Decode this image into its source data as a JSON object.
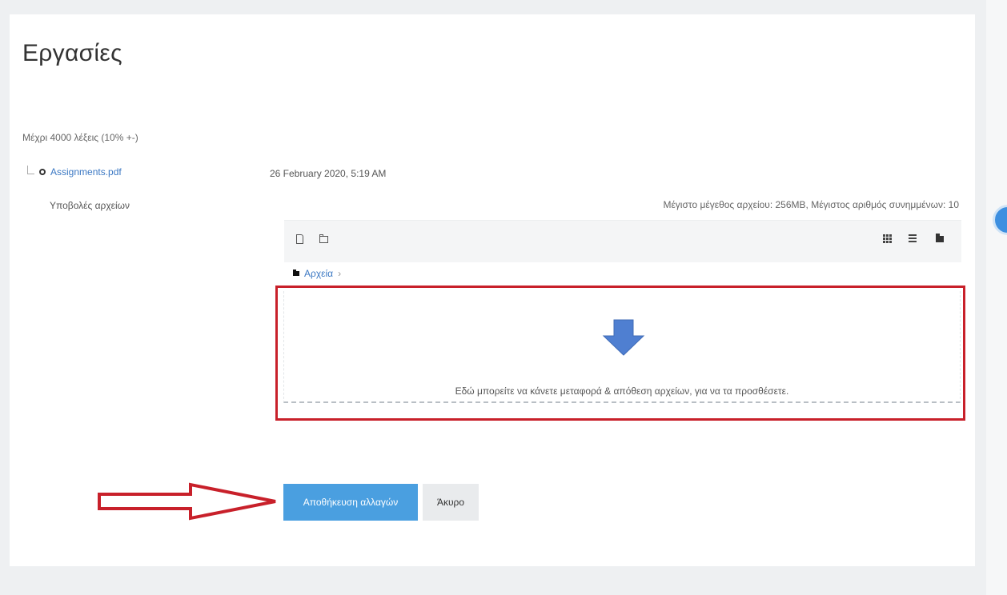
{
  "page": {
    "title": "Εργασίες"
  },
  "submission": {
    "word_limit": "Μέχρι 4000 λέξεις (10% +-)",
    "file_name": "Assignments.pdf",
    "label": "Υποβολές αρχείων",
    "date": "26 February 2020, 5:19 AM",
    "max_info": "Μέγιστο μέγεθος αρχείου: 256MB, Μέγιστος αριθμός συνημμένων: 10"
  },
  "filepicker": {
    "toolbar_icons": [
      "add-file-icon",
      "create-folder-icon",
      "icon-view-icon",
      "list-view-icon",
      "tree-view-icon"
    ],
    "breadcrumb": "Αρχεία",
    "dropzone_text": "Εδώ μπορείτε να κάνετε μεταφορά & απόθεση αρχείων, για να τα προσθέσετε."
  },
  "buttons": {
    "save": "Αποθήκευση αλλαγών",
    "cancel": "Άκυρο"
  },
  "colors": {
    "primary": "#4a9fe0",
    "annotation_red": "#c8202a",
    "link": "#3b78c3"
  }
}
